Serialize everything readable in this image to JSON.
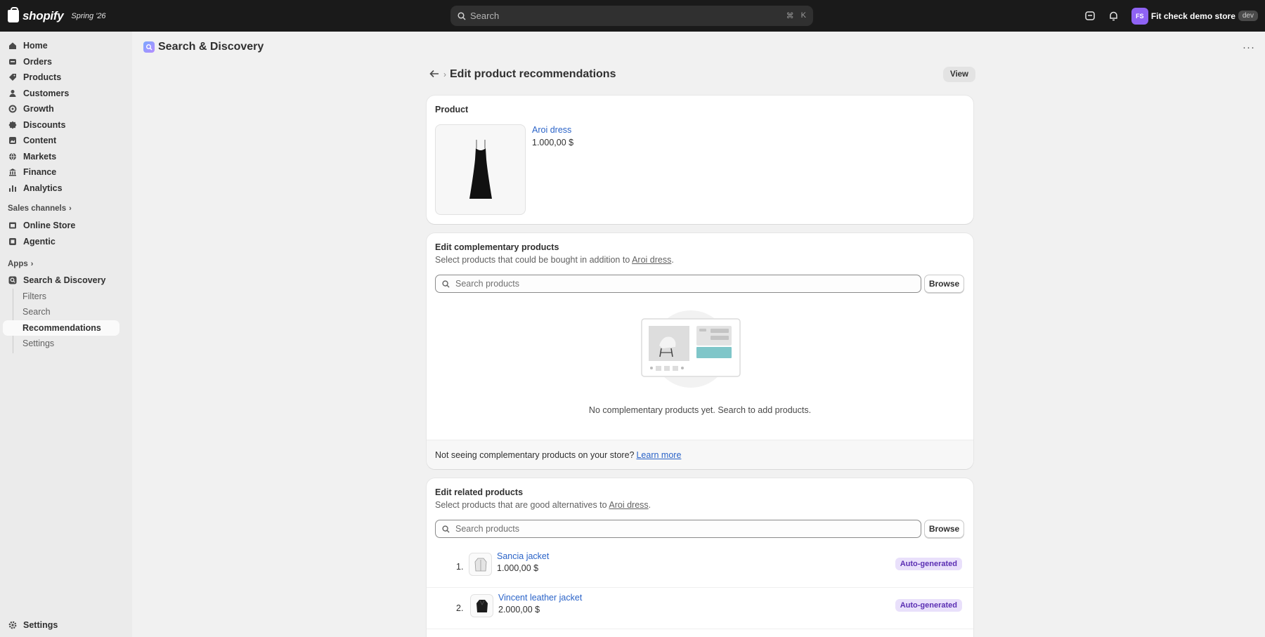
{
  "topbar": {
    "logo_text": "shopify",
    "edition": "Spring '26",
    "search_placeholder": "Search",
    "shortcut_cmd": "⌘",
    "shortcut_key": "K",
    "avatar_initials": "FS",
    "store_name": "Fit check demo store",
    "store_badge": "dev"
  },
  "sidebar": {
    "items": [
      {
        "label": "Home",
        "icon": "home-icon"
      },
      {
        "label": "Orders",
        "icon": "orders-icon"
      },
      {
        "label": "Products",
        "icon": "tag-icon"
      },
      {
        "label": "Customers",
        "icon": "person-icon"
      },
      {
        "label": "Growth",
        "icon": "growth-icon"
      },
      {
        "label": "Discounts",
        "icon": "discount-icon"
      },
      {
        "label": "Content",
        "icon": "content-icon"
      },
      {
        "label": "Markets",
        "icon": "globe-icon"
      },
      {
        "label": "Finance",
        "icon": "bank-icon"
      },
      {
        "label": "Analytics",
        "icon": "chart-icon"
      }
    ],
    "sales_channels_label": "Sales channels",
    "channels": [
      {
        "label": "Online Store",
        "icon": "store-icon"
      },
      {
        "label": "Agentic",
        "icon": "agentic-icon"
      }
    ],
    "apps_label": "Apps",
    "app": {
      "label": "Search & Discovery",
      "icon": "search-discovery-icon"
    },
    "app_sub": [
      "Filters",
      "Search",
      "Recommendations",
      "Settings"
    ],
    "settings_label": "Settings"
  },
  "app_header": {
    "title": "Search & Discovery",
    "more": "···"
  },
  "page": {
    "title": "Edit product recommendations",
    "view_button": "View"
  },
  "product_card": {
    "title": "Product",
    "product_name": "Aroi dress",
    "price": "1.000,00 $"
  },
  "complementary": {
    "title": "Edit complementary products",
    "subtitle_prefix": "Select products that could be bought in addition to ",
    "subtitle_link": "Aroi dress",
    "subtitle_suffix": ".",
    "search_placeholder": "Search products",
    "browse": "Browse",
    "empty_text": "No complementary products yet. Search to add products.",
    "footer_text": "Not seeing complementary products on your store?",
    "footer_link": "Learn more"
  },
  "related": {
    "title": "Edit related products",
    "subtitle_prefix": "Select products that are good alternatives to ",
    "subtitle_link": "Aroi dress",
    "subtitle_suffix": ".",
    "search_placeholder": "Search products",
    "browse": "Browse",
    "items": [
      {
        "num": "1.",
        "name": "Sancia jacket",
        "price": "1.000,00 $",
        "badge": "Auto-generated"
      },
      {
        "num": "2.",
        "name": "Vincent leather jacket",
        "price": "2.000,00 $",
        "badge": "Auto-generated"
      }
    ]
  },
  "colors": {
    "topbar": "#1a1a1a",
    "link": "#2a63c8",
    "badge_bg": "#e9e0fb",
    "badge_text": "#5b2fb3",
    "avatar": "#8f63f4"
  }
}
